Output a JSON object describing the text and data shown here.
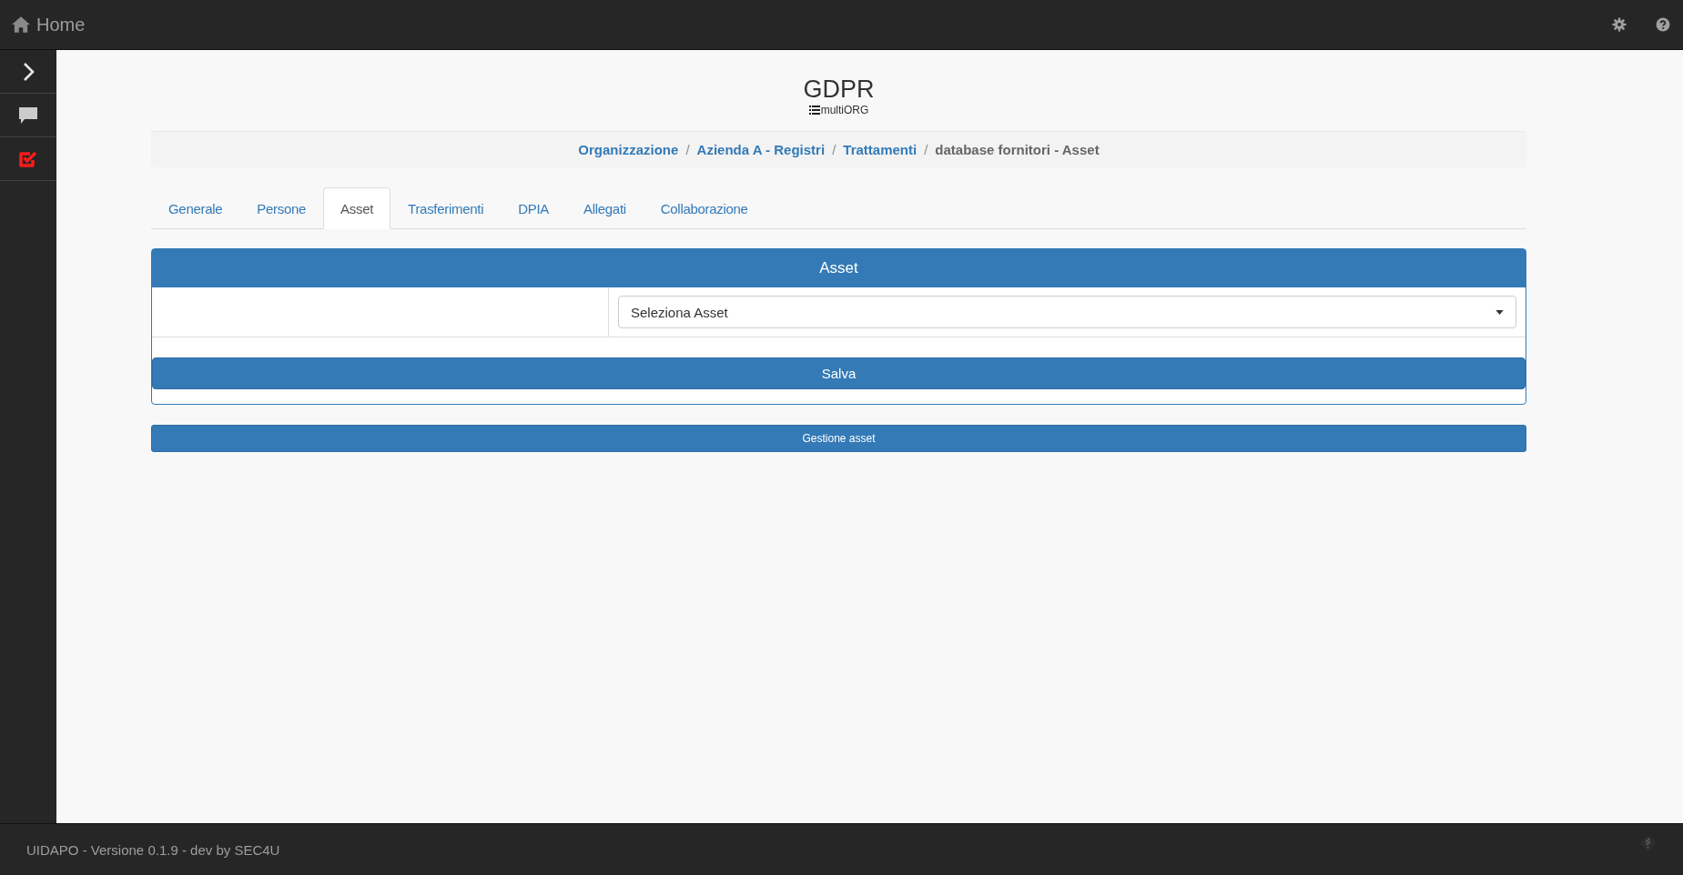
{
  "topbar": {
    "home_label": "Home"
  },
  "sidebar": {
    "items": [
      {
        "kind": "chevron"
      },
      {
        "kind": "chat"
      },
      {
        "kind": "check"
      }
    ]
  },
  "header": {
    "title": "GDPR",
    "subtitle": "multiORG"
  },
  "breadcrumb": [
    {
      "label": "Organizzazione",
      "current": false
    },
    {
      "separator": "/",
      "label": "Azienda A - Registri",
      "current": false
    },
    {
      "separator": "/",
      "label": "Trattamenti",
      "current": false
    },
    {
      "separator": "/",
      "label": "database fornitori - Asset",
      "current": true
    }
  ],
  "tabs": [
    {
      "label": "Generale",
      "selected": false
    },
    {
      "label": "Persone",
      "selected": false
    },
    {
      "label": "Asset",
      "selected": true
    },
    {
      "label": "Trasferimenti",
      "selected": false
    },
    {
      "label": "DPIA",
      "selected": false
    },
    {
      "label": "Allegati",
      "selected": false
    },
    {
      "label": "Collaborazione",
      "selected": false
    }
  ],
  "panel": {
    "title": "Asset",
    "select": {
      "value": "Seleziona Asset"
    },
    "save_button": "Salva"
  },
  "manage_button": "Gestione asset",
  "footer": {
    "text": "UIDAPO - Versione 0.1.9 - dev by SEC4U"
  }
}
